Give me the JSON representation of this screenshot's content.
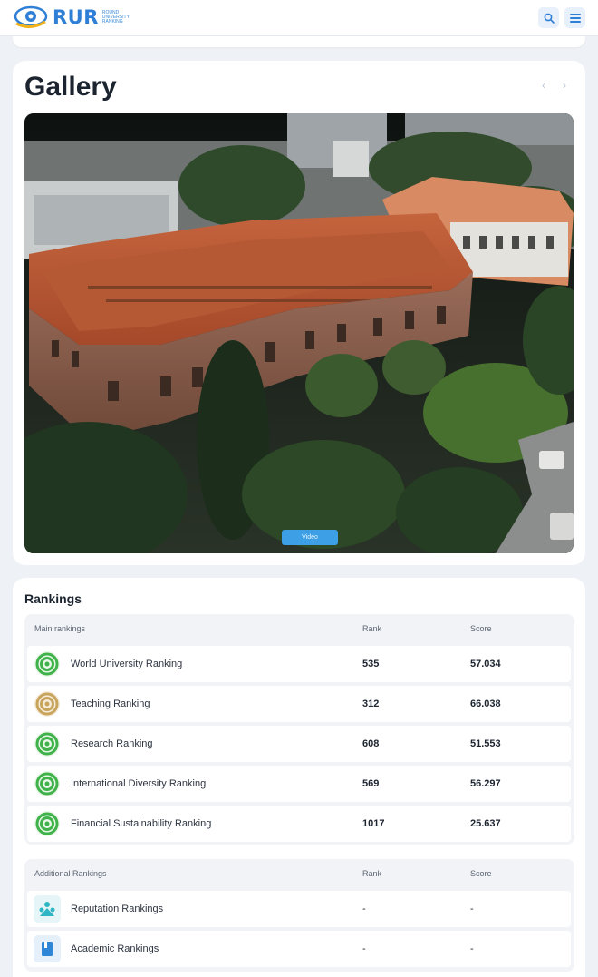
{
  "header": {
    "logo_text": "RUR",
    "logo_subtext": "Round University Ranking",
    "search_icon": "search-icon",
    "menu_icon": "hamburger-menu-icon"
  },
  "gallery": {
    "title": "Gallery",
    "prev_icon": "chevron-left-icon",
    "next_icon": "chevron-right-icon",
    "image_label": "campus-aerial-photo",
    "badge_text": "Video"
  },
  "rankings": {
    "title": "Rankings",
    "main": {
      "headers": {
        "name": "Main rankings",
        "rank": "Rank",
        "score": "Score"
      },
      "rows": [
        {
          "name": "World University Ranking",
          "rank": "535",
          "score": "57.034",
          "icon_color": "#3fb34a"
        },
        {
          "name": "Teaching Ranking",
          "rank": "312",
          "score": "66.038",
          "icon_color": "#c9a45c"
        },
        {
          "name": "Research Ranking",
          "rank": "608",
          "score": "51.553",
          "icon_color": "#3fb34a"
        },
        {
          "name": "International Diversity Ranking",
          "rank": "569",
          "score": "56.297",
          "icon_color": "#3fb34a"
        },
        {
          "name": "Financial Sustainability Ranking",
          "rank": "1017",
          "score": "25.637",
          "icon_color": "#3fb34a"
        }
      ]
    },
    "additional": {
      "headers": {
        "name": "Additional Rankings",
        "rank": "Rank",
        "score": "Score"
      },
      "rows": [
        {
          "name": "Reputation Rankings",
          "rank": "-",
          "score": "-",
          "icon": "reputation-icon",
          "icon_color": "#2fb5c4"
        },
        {
          "name": "Academic Rankings",
          "rank": "-",
          "score": "-",
          "icon": "book-icon",
          "icon_color": "#2f86d6"
        }
      ]
    }
  }
}
